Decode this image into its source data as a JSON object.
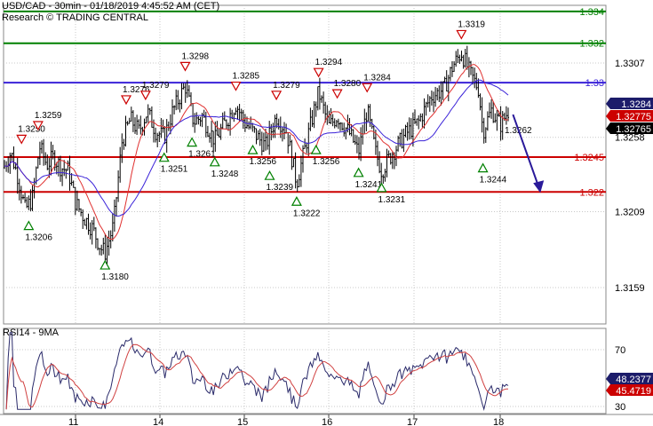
{
  "header": {
    "title": "USD/CAD - 30min - 01/18/2019 4:45:52 AM (CET)",
    "credit": "Research © TRADING CENTRAL"
  },
  "colors": {
    "background": "#ffffff",
    "grid": "#c8c8c8",
    "price": "#000000",
    "resistance_green": "#008000",
    "pivot_blue": "#3a22d8",
    "support_red": "#cc0000",
    "ma_fast": "#e0302f",
    "ma_slow": "#3a22d8",
    "arrow": "#2a1a9a",
    "marker_red": "#cc0000",
    "marker_green": "#008000",
    "rsi": "#2a2a6a",
    "rsi_ma": "#d04040"
  },
  "chart_data": [
    {
      "type": "candlestick",
      "title": "USD/CAD - 30min - 01/18/2019 4:45:52 AM (CET)",
      "ylim": [
        1.3135,
        1.3345
      ],
      "y_ticks": [
        "1.3307",
        "1.3258",
        "1.3209",
        "1.3159"
      ],
      "x_ticks": [
        "11",
        "14",
        "15",
        "16",
        "17",
        "18"
      ],
      "grid": true,
      "key_levels": [
        {
          "label": "1.334",
          "value": 1.3341,
          "role": "resistance",
          "color": "#008000"
        },
        {
          "label": "1.332",
          "value": 1.332,
          "role": "resistance",
          "color": "#008000"
        },
        {
          "label": "1.33",
          "value": 1.3294,
          "role": "pivot",
          "color": "#3a22d8"
        },
        {
          "label": "1.3245",
          "value": 1.3245,
          "role": "support",
          "color": "#cc0000"
        },
        {
          "label": "1.322",
          "value": 1.3222,
          "role": "support",
          "color": "#cc0000"
        }
      ],
      "price_tags": [
        {
          "label": "1.3284",
          "value": 1.3284,
          "bg": "#1c1c6a"
        },
        {
          "label": "1.32775",
          "value": 1.32775,
          "bg": "#cc0000"
        },
        {
          "label": "1.32765",
          "value": 1.32765,
          "bg": "#000000"
        }
      ],
      "swing_points": [
        {
          "label": "1.3250",
          "value": 1.325,
          "kind": "high",
          "x_day": 10.25
        },
        {
          "label": "1.3259",
          "value": 1.3259,
          "kind": "high",
          "x_day": 10.48
        },
        {
          "label": "1.3206",
          "value": 1.3206,
          "kind": "low",
          "x_day": 10.35
        },
        {
          "label": "1.3180",
          "value": 1.318,
          "kind": "low",
          "x_day": 11.35
        },
        {
          "label": "1.3276",
          "value": 1.3276,
          "kind": "high",
          "x_day": 11.6
        },
        {
          "label": "1.3279",
          "value": 1.3279,
          "kind": "high",
          "x_day": 11.83
        },
        {
          "label": "1.3251",
          "value": 1.3251,
          "kind": "low",
          "x_day": 14.05
        },
        {
          "label": "1.3298",
          "value": 1.3298,
          "kind": "high",
          "x_day": 14.3
        },
        {
          "label": "1.3261",
          "value": 1.3261,
          "kind": "low",
          "x_day": 14.38
        },
        {
          "label": "1.3248",
          "value": 1.3248,
          "kind": "low",
          "x_day": 14.65
        },
        {
          "label": "1.3285",
          "value": 1.3285,
          "kind": "high",
          "x_day": 14.9
        },
        {
          "label": "1.3256",
          "value": 1.3256,
          "kind": "low",
          "x_day": 15.1
        },
        {
          "label": "1.3279",
          "value": 1.3279,
          "kind": "high",
          "x_day": 15.38
        },
        {
          "label": "1.3239",
          "value": 1.3239,
          "kind": "low",
          "x_day": 15.3
        },
        {
          "label": "1.3222",
          "value": 1.3222,
          "kind": "low",
          "x_day": 15.62
        },
        {
          "label": "1.3294",
          "value": 1.3294,
          "kind": "high",
          "x_day": 15.88
        },
        {
          "label": "1.3256",
          "value": 1.3256,
          "kind": "low",
          "x_day": 15.85
        },
        {
          "label": "1.3280",
          "value": 1.328,
          "kind": "high",
          "x_day": 16.1
        },
        {
          "label": "1.3284",
          "value": 1.3284,
          "kind": "high",
          "x_day": 16.45
        },
        {
          "label": "1.3241",
          "value": 1.3241,
          "kind": "low",
          "x_day": 16.35
        },
        {
          "label": "1.3231",
          "value": 1.3231,
          "kind": "low",
          "x_day": 16.62
        },
        {
          "label": "1.3319",
          "value": 1.3319,
          "kind": "high",
          "x_day": 17.55
        },
        {
          "label": "1.3244",
          "value": 1.3244,
          "kind": "low",
          "x_day": 17.8
        },
        {
          "label": "1.3262",
          "value": 1.3262,
          "kind": "annotation",
          "x_day": 18.0
        }
      ],
      "forecast_arrow": {
        "from": {
          "x_day": 18.15,
          "value": 1.3273
        },
        "to": {
          "x_day": 18.45,
          "value": 1.3222
        }
      },
      "price_path": [
        {
          "x_day": 10.0,
          "value": 1.3238
        },
        {
          "x_day": 10.1,
          "value": 1.3248
        },
        {
          "x_day": 10.2,
          "value": 1.3232
        },
        {
          "x_day": 10.3,
          "value": 1.321
        },
        {
          "x_day": 10.4,
          "value": 1.3218
        },
        {
          "x_day": 10.5,
          "value": 1.3252
        },
        {
          "x_day": 10.6,
          "value": 1.324
        },
        {
          "x_day": 10.7,
          "value": 1.3245
        },
        {
          "x_day": 10.8,
          "value": 1.3238
        },
        {
          "x_day": 10.9,
          "value": 1.3236
        },
        {
          "x_day": 11.0,
          "value": 1.3215
        },
        {
          "x_day": 11.1,
          "value": 1.3205
        },
        {
          "x_day": 11.2,
          "value": 1.3198
        },
        {
          "x_day": 11.3,
          "value": 1.3185
        },
        {
          "x_day": 11.35,
          "value": 1.3182
        },
        {
          "x_day": 11.45,
          "value": 1.32
        },
        {
          "x_day": 11.55,
          "value": 1.3255
        },
        {
          "x_day": 11.65,
          "value": 1.327
        },
        {
          "x_day": 11.75,
          "value": 1.3262
        },
        {
          "x_day": 11.85,
          "value": 1.3275
        },
        {
          "x_day": 11.95,
          "value": 1.3262
        },
        {
          "x_day": 14.05,
          "value": 1.3258
        },
        {
          "x_day": 14.15,
          "value": 1.3275
        },
        {
          "x_day": 14.3,
          "value": 1.3292
        },
        {
          "x_day": 14.4,
          "value": 1.3268
        },
        {
          "x_day": 14.5,
          "value": 1.3272
        },
        {
          "x_day": 14.65,
          "value": 1.3256
        },
        {
          "x_day": 14.8,
          "value": 1.327
        },
        {
          "x_day": 14.9,
          "value": 1.328
        },
        {
          "x_day": 15.0,
          "value": 1.3268
        },
        {
          "x_day": 15.1,
          "value": 1.3262
        },
        {
          "x_day": 15.25,
          "value": 1.3252
        },
        {
          "x_day": 15.38,
          "value": 1.3272
        },
        {
          "x_day": 15.5,
          "value": 1.3262
        },
        {
          "x_day": 15.62,
          "value": 1.3228
        },
        {
          "x_day": 15.75,
          "value": 1.3258
        },
        {
          "x_day": 15.88,
          "value": 1.3288
        },
        {
          "x_day": 16.0,
          "value": 1.3265
        },
        {
          "x_day": 16.1,
          "value": 1.3272
        },
        {
          "x_day": 16.25,
          "value": 1.326
        },
        {
          "x_day": 16.35,
          "value": 1.3248
        },
        {
          "x_day": 16.45,
          "value": 1.3276
        },
        {
          "x_day": 16.55,
          "value": 1.3248
        },
        {
          "x_day": 16.62,
          "value": 1.3236
        },
        {
          "x_day": 16.75,
          "value": 1.3248
        },
        {
          "x_day": 16.9,
          "value": 1.326
        },
        {
          "x_day": 17.05,
          "value": 1.3268
        },
        {
          "x_day": 17.2,
          "value": 1.3285
        },
        {
          "x_day": 17.35,
          "value": 1.329
        },
        {
          "x_day": 17.45,
          "value": 1.3305
        },
        {
          "x_day": 17.55,
          "value": 1.3314
        },
        {
          "x_day": 17.65,
          "value": 1.33
        },
        {
          "x_day": 17.75,
          "value": 1.329
        },
        {
          "x_day": 17.8,
          "value": 1.3262
        },
        {
          "x_day": 17.9,
          "value": 1.3276
        },
        {
          "x_day": 18.0,
          "value": 1.3266
        },
        {
          "x_day": 18.1,
          "value": 1.3276
        }
      ]
    },
    {
      "type": "line",
      "title": "RSI14 - 9MA",
      "ylim": [
        25,
        85
      ],
      "y_ticks": [
        "70",
        "30"
      ],
      "current_values": [
        {
          "label": "48.2377",
          "value": 48.2377,
          "bg": "#1c1c6a"
        },
        {
          "label": "45.4719",
          "value": 45.4719,
          "bg": "#cc0000"
        }
      ]
    }
  ]
}
